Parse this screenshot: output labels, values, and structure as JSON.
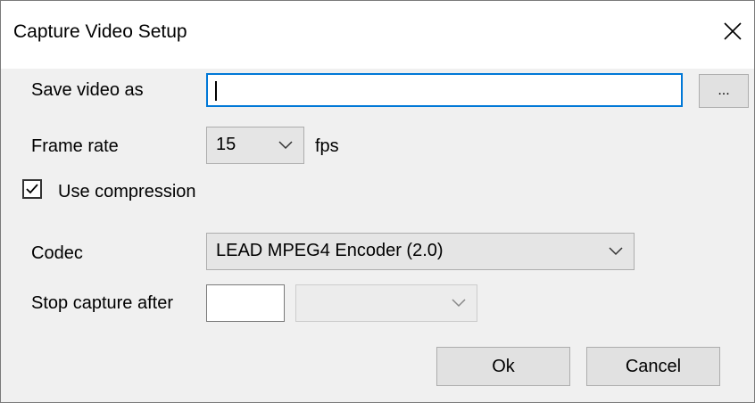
{
  "window": {
    "title": "Capture Video Setup"
  },
  "fields": {
    "save_video_label": "Save video as",
    "save_video_value": "",
    "browse_label": "...",
    "frame_rate_label": "Frame rate",
    "frame_rate_value": "15",
    "fps_label": "fps",
    "use_compression_label": "Use compression",
    "use_compression_checked": true,
    "codec_label": "Codec",
    "codec_value": "LEAD MPEG4 Encoder (2.0)",
    "stop_capture_label": "Stop capture after",
    "stop_capture_value": "",
    "stop_capture_unit": ""
  },
  "buttons": {
    "ok": "Ok",
    "cancel": "Cancel"
  },
  "icons": {
    "close": "close-icon",
    "dropdown": "chevron-down-icon",
    "check": "checkmark-icon"
  },
  "colors": {
    "focus_border": "#0078d7",
    "dialog_bg": "#f0f0f0"
  }
}
